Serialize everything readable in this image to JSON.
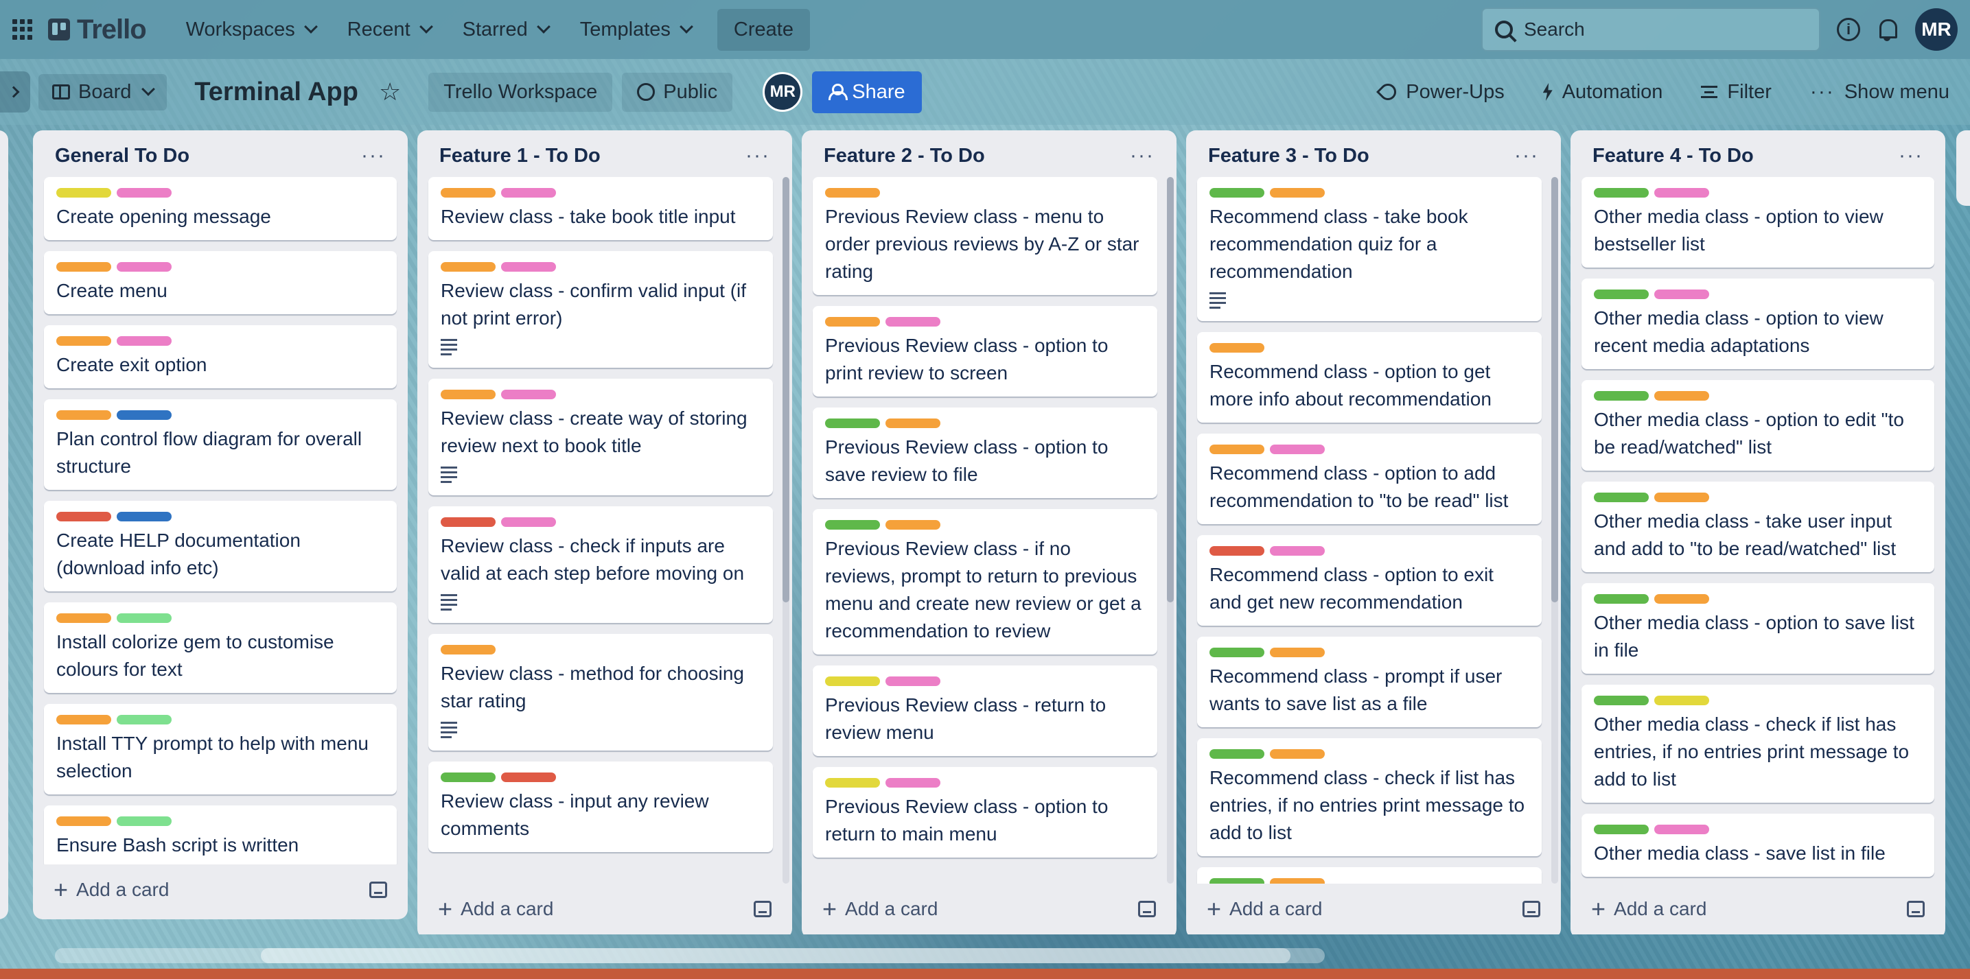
{
  "nav": {
    "logo": "Trello",
    "menu": [
      {
        "label": "Workspaces"
      },
      {
        "label": "Recent"
      },
      {
        "label": "Starred"
      },
      {
        "label": "Templates"
      }
    ],
    "create_label": "Create",
    "search_placeholder": "Search",
    "avatar_initials": "MR"
  },
  "board": {
    "view_label": "Board",
    "title": "Terminal App",
    "workspace_label": "Trello Workspace",
    "visibility_label": "Public",
    "member_initials": "MR",
    "share_label": "Share",
    "power_ups_label": "Power-Ups",
    "automation_label": "Automation",
    "filter_label": "Filter",
    "show_menu_label": "Show menu"
  },
  "label_colors": {
    "yellow": "#e2d83b",
    "pink": "#ec7ec6",
    "orange": "#f5a13a",
    "blue": "#2f73c2",
    "red": "#df5a45",
    "lightgreen": "#7ee08f",
    "green": "#5fb84a"
  },
  "add_card_label": "Add a card",
  "lists": [
    {
      "title": "General To Do",
      "cards": [
        {
          "labels": [
            "yellow",
            "pink"
          ],
          "title": "Create opening message"
        },
        {
          "labels": [
            "orange",
            "pink"
          ],
          "title": "Create menu"
        },
        {
          "labels": [
            "orange",
            "pink"
          ],
          "title": "Create exit option"
        },
        {
          "labels": [
            "orange",
            "blue"
          ],
          "title": "Plan control flow diagram for overall structure"
        },
        {
          "labels": [
            "red",
            "blue"
          ],
          "title": "Create HELP documentation (download info etc)"
        },
        {
          "labels": [
            "orange",
            "lightgreen"
          ],
          "title": "Install colorize gem to customise colours for text"
        },
        {
          "labels": [
            "orange",
            "lightgreen"
          ],
          "title": "Install TTY prompt to help with menu selection"
        },
        {
          "labels": [
            "orange",
            "lightgreen"
          ],
          "title": "Ensure Bash script is written"
        }
      ]
    },
    {
      "title": "Feature 1 - To Do",
      "cards": [
        {
          "labels": [
            "orange",
            "pink"
          ],
          "title": "Review class - take book title input"
        },
        {
          "labels": [
            "orange",
            "pink"
          ],
          "title": "Review class - confirm valid input (if not print error)",
          "desc": true
        },
        {
          "labels": [
            "orange",
            "pink"
          ],
          "title": "Review class - create way of storing review next to book title",
          "desc": true
        },
        {
          "labels": [
            "red",
            "pink"
          ],
          "title": "Review class - check if inputs are valid at each step before moving on",
          "desc": true
        },
        {
          "labels": [
            "orange"
          ],
          "title": "Review class - method for choosing star rating",
          "desc": true
        },
        {
          "labels": [
            "green",
            "red"
          ],
          "title": "Review class - input any review comments"
        }
      ]
    },
    {
      "title": "Feature 2 - To Do",
      "cards": [
        {
          "labels": [
            "orange"
          ],
          "title": "Previous Review class - menu to order previous reviews by A-Z or star rating"
        },
        {
          "labels": [
            "orange",
            "pink"
          ],
          "title": "Previous Review class - option to print review to screen"
        },
        {
          "labels": [
            "green",
            "orange"
          ],
          "title": "Previous Review class - option to save review to file"
        },
        {
          "labels": [
            "green",
            "orange"
          ],
          "title": "Previous Review class - if no reviews, prompt to return to previous menu and create new review or get a recommendation to review"
        },
        {
          "labels": [
            "yellow",
            "pink"
          ],
          "title": "Previous Review class - return to review menu"
        },
        {
          "labels": [
            "yellow",
            "pink"
          ],
          "title": "Previous Review class - option to return to main menu"
        }
      ]
    },
    {
      "title": "Feature 3 - To Do",
      "cards": [
        {
          "labels": [
            "green",
            "orange"
          ],
          "title": "Recommend class - take book recommendation quiz for a recommendation",
          "desc": true
        },
        {
          "labels": [
            "orange"
          ],
          "title": "Recommend class - option to get more info about recommendation"
        },
        {
          "labels": [
            "orange",
            "pink"
          ],
          "title": "Recommend class - option to add recommendation to \"to be read\" list"
        },
        {
          "labels": [
            "red",
            "pink"
          ],
          "title": "Recommend class - option to exit and get new recommendation"
        },
        {
          "labels": [
            "green",
            "orange"
          ],
          "title": "Recommend class - prompt if user wants to save list as a file"
        },
        {
          "labels": [
            "green",
            "orange"
          ],
          "title": "Recommend class - check if list has entries, if no entries print message to add to list"
        },
        {
          "labels": [
            "green",
            "orange"
          ],
          "title": ""
        }
      ]
    },
    {
      "title": "Feature 4 - To Do",
      "cards": [
        {
          "labels": [
            "green",
            "pink"
          ],
          "title": "Other media class - option to view bestseller list"
        },
        {
          "labels": [
            "green",
            "pink"
          ],
          "title": "Other media class - option to view recent media adaptations"
        },
        {
          "labels": [
            "green",
            "orange"
          ],
          "title": "Other media class - option to edit \"to be read/watched\" list"
        },
        {
          "labels": [
            "green",
            "orange"
          ],
          "title": "Other media class - take user input and add to \"to be read/watched\" list"
        },
        {
          "labels": [
            "green",
            "orange"
          ],
          "title": "Other media class - option to save list in file"
        },
        {
          "labels": [
            "green",
            "yellow"
          ],
          "title": "Other media class - check if list has entries, if no entries print message to add to list"
        },
        {
          "labels": [
            "green",
            "pink"
          ],
          "title": "Other media class - save list in file"
        }
      ]
    }
  ]
}
